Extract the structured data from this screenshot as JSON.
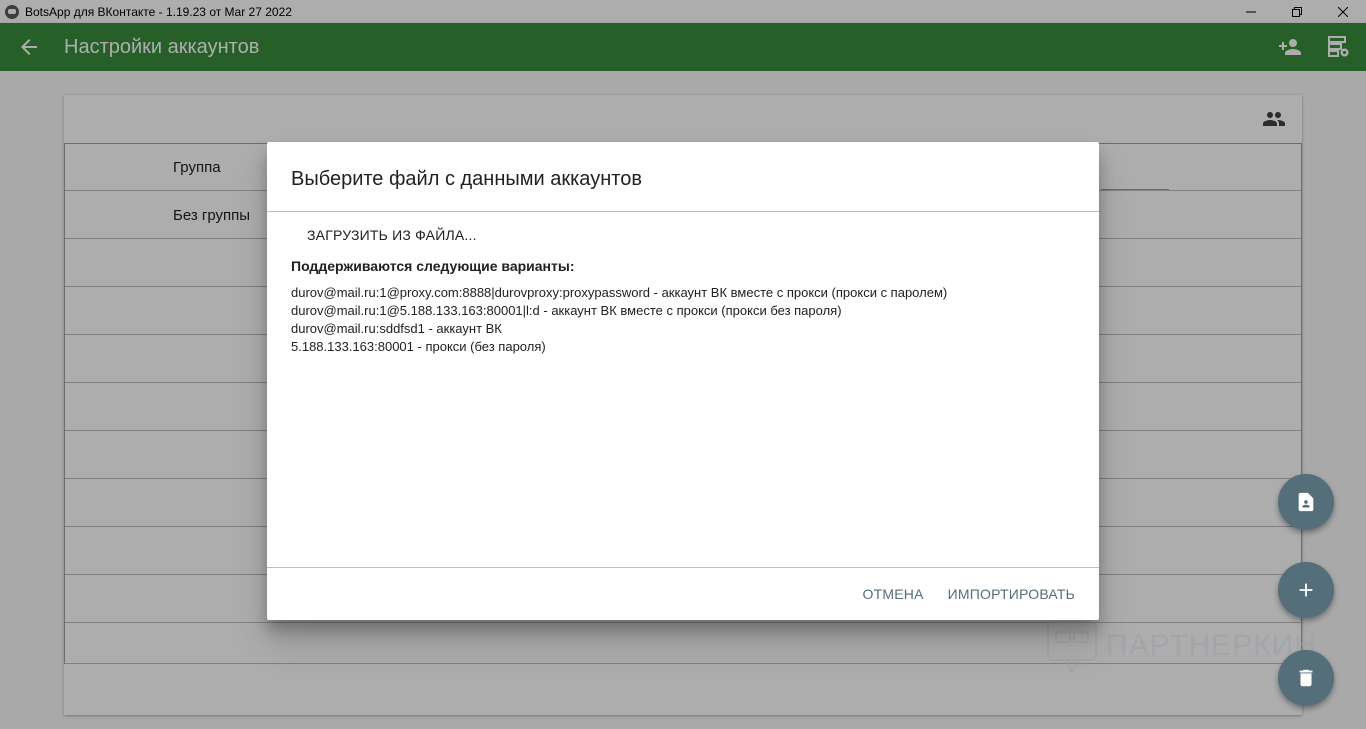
{
  "window": {
    "title": "BotsApp для ВКонтакте - 1.19.23 от Mar 27 2022",
    "controls": [
      "minimize-icon",
      "restore-icon",
      "close-icon"
    ]
  },
  "appbar": {
    "title": "Настройки аккаунтов",
    "color": "#388e3c",
    "icons": [
      "back-arrow-icon",
      "add-person-icon",
      "proxy-settings-icon"
    ]
  },
  "table": {
    "header_icon": "people-icon",
    "rows": [
      "Группа",
      "Без группы",
      "",
      "",
      "",
      "",
      "",
      "",
      "",
      "",
      ""
    ]
  },
  "dialog": {
    "title": "Выберите файл с данными аккаунтов",
    "load_button": "ЗАГРУЗИТЬ ИЗ ФАЙЛА...",
    "supported_label": "Поддерживаются следующие варианты:",
    "examples": [
      "durov@mail.ru:1@proxy.com:8888|durovproxy:proxypassword - аккаунт ВК вместе с прокси (прокси с паролем)",
      "durov@mail.ru:1@5.188.133.163:80001|l:d - аккаунт ВК вместе с прокси (прокси без пароля)",
      "durov@mail.ru:sddfsd1 - аккаунт ВК",
      "5.188.133.163:80001 - прокси (без пароля)"
    ],
    "cancel_label": "ОТМЕНА",
    "import_label": "ИМПОРТИРОВАТЬ",
    "action_color": "#546e7a"
  },
  "fabs": [
    "file-icon",
    "add-icon",
    "delete-icon"
  ],
  "watermark": "ПАРТНЕРКИН"
}
